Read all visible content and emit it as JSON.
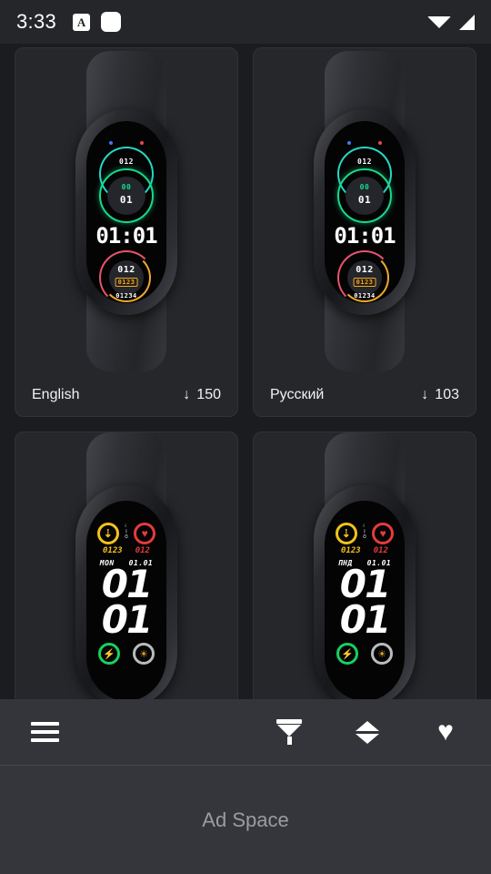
{
  "status_bar": {
    "clock": "3:33",
    "icons": [
      "app-mark-icon",
      "rounded-square-icon",
      "wifi-icon",
      "cellular-signal-icon"
    ],
    "app_mark_glyph": "A",
    "background": "#25262a"
  },
  "theme": {
    "page_background": "#1b1c20",
    "card_background": "#26272b",
    "card_border": "#313237",
    "bottom_bar_background": "#33353a",
    "ad_background": "#34363b",
    "accent_text": "#ffffff"
  },
  "grid": {
    "cards": [
      {
        "id": "card-1",
        "language": "English",
        "downloads": "150",
        "download_icon": "download-arrow-icon",
        "face_type": "rings",
        "face": {
          "top_value": "012",
          "center_badge": "00",
          "center_value": "01",
          "time": "01:01",
          "lower_value": "012",
          "lower_chip": "0123",
          "bottom_value": "01234",
          "ring_colors": {
            "top_arc": "#24d8c4",
            "main_ring": "#17d98a",
            "red_arc": "#e8536b",
            "orange_arc": "#f0a82a",
            "blue_arc": "#2aa8ef",
            "chip": "#e9a92b"
          },
          "indicator_dots": [
            "#3b7bf0",
            "#e84848"
          ]
        }
      },
      {
        "id": "card-2",
        "language": "Русский",
        "downloads": "103",
        "download_icon": "download-arrow-icon",
        "face_type": "rings",
        "face": {
          "top_value": "012",
          "center_badge": "00",
          "center_value": "01",
          "time": "01:01",
          "lower_value": "012",
          "lower_chip": "0123",
          "bottom_value": "01234",
          "ring_colors": {
            "top_arc": "#24d8c4",
            "main_ring": "#17d98a",
            "red_arc": "#e8536b",
            "orange_arc": "#f0a82a",
            "blue_arc": "#2aa8ef",
            "chip": "#e9a92b"
          },
          "indicator_dots": [
            "#3b7bf0",
            "#e84848"
          ]
        }
      },
      {
        "id": "card-3",
        "language": "",
        "downloads": "",
        "download_icon": "",
        "face_type": "digits",
        "face": {
          "steps_glyph": "⇣",
          "steps_value": "0123",
          "heart_glyph": "♥",
          "heart_value": "012",
          "mini_icons": [
            "moon-icon",
            "bluetooth-icon",
            "alarm-icon"
          ],
          "weekday": "MON",
          "date": "01.01",
          "hour": "01",
          "minute": "01",
          "battery_glyph": "⚡",
          "weather_glyph": "☀",
          "colors": {
            "steps": "#f2c318",
            "heart": "#e43b3b",
            "battery": "#17d05e",
            "weather": "#b9bbbd"
          }
        }
      },
      {
        "id": "card-4",
        "language": "",
        "downloads": "",
        "download_icon": "",
        "face_type": "digits",
        "face": {
          "steps_glyph": "⇣",
          "steps_value": "0123",
          "heart_glyph": "♥",
          "heart_value": "012",
          "mini_icons": [
            "moon-icon",
            "bluetooth-icon",
            "alarm-icon"
          ],
          "weekday": "ПНД",
          "date": "01.01",
          "hour": "01",
          "minute": "01",
          "battery_glyph": "⚡",
          "weather_glyph": "☀",
          "colors": {
            "steps": "#f2c318",
            "heart": "#e43b3b",
            "battery": "#17d05e",
            "weather": "#b9bbbd"
          }
        }
      }
    ]
  },
  "bottom_bar": {
    "menu_icon": "hamburger-menu-icon",
    "filter_icon": "filter-funnel-icon",
    "sort_icon": "sort-updown-icon",
    "favorites_icon": "heart-icon",
    "favorites_glyph": "♥"
  },
  "ad": {
    "label": "Ad Space"
  }
}
